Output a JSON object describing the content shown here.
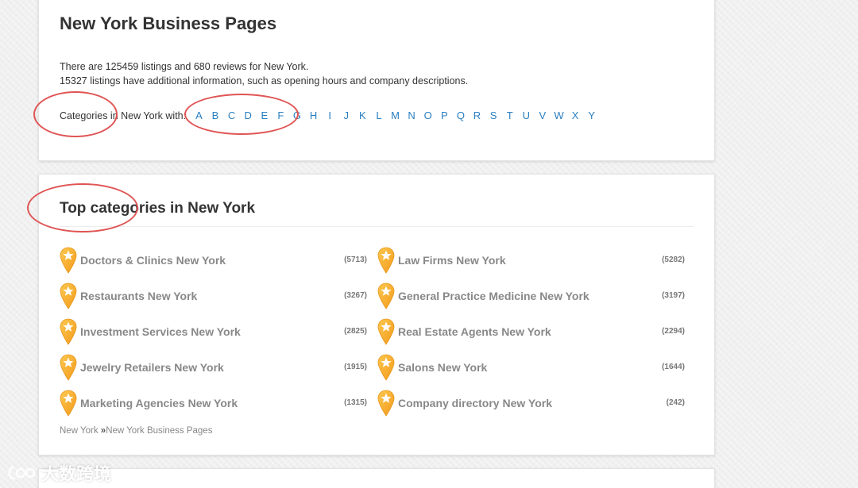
{
  "header": {
    "title": "New York Business Pages",
    "info_line_1": "There are 125459 listings and 680 reviews for New York.",
    "info_line_2": "15327 listings have additional information, such as opening hours and company descriptions.",
    "letters_label": "Categories in New York with:",
    "letters": [
      "A",
      "B",
      "C",
      "D",
      "E",
      "F",
      "G",
      "H",
      "I",
      "J",
      "K",
      "L",
      "M",
      "N",
      "O",
      "P",
      "Q",
      "R",
      "S",
      "T",
      "U",
      "V",
      "W",
      "X",
      "Y"
    ]
  },
  "top_categories": {
    "title": "Top categories in New York",
    "items": [
      {
        "name": "Doctors & Clinics New York",
        "count": "(5713)"
      },
      {
        "name": "Law Firms New York",
        "count": "(5282)"
      },
      {
        "name": "Restaurants New York",
        "count": "(3267)"
      },
      {
        "name": "General Practice Medicine New York",
        "count": "(3197)"
      },
      {
        "name": "Investment Services New York",
        "count": "(2825)"
      },
      {
        "name": "Real Estate Agents New York",
        "count": "(2294)"
      },
      {
        "name": "Jewelry Retailers New York",
        "count": "(1915)"
      },
      {
        "name": "Salons New York",
        "count": "(1644)"
      },
      {
        "name": "Marketing Agencies New York",
        "count": "(1315)"
      },
      {
        "name": "Company directory New York",
        "count": "(242)"
      }
    ]
  },
  "breadcrumb": {
    "home": "New York",
    "separator": "»",
    "current": "New York Business Pages"
  },
  "watermark": {
    "text": "大数跨境"
  },
  "colors": {
    "link": "#2a7fc1",
    "annotation": "#e05454",
    "pin": "#f5a623"
  }
}
